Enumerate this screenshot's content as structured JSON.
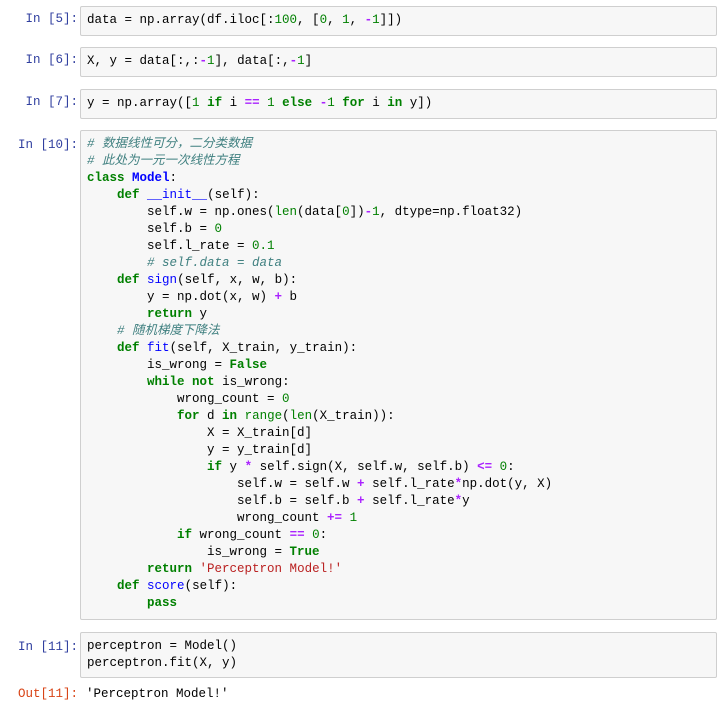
{
  "cells": [
    {
      "prompt": "In  [5]:",
      "lines": [
        "data = np.array(df.iloc[:100, [0, 1, -1]])"
      ]
    },
    {
      "prompt": "In  [6]:",
      "lines": [
        "X, y = data[:,:-1], data[:,-1]"
      ]
    },
    {
      "prompt": "In  [7]:",
      "lines": [
        "y = np.array([1 if i == 1 else -1 for i in y])"
      ]
    },
    {
      "prompt": "In  [10]:",
      "lines": [
        "# 数据线性可分，二分类数据",
        "# 此处为一元一次线性方程",
        "class Model:",
        "    def __init__(self):",
        "        self.w = np.ones(len(data[0])-1, dtype=np.float32)",
        "        self.b = 0",
        "        self.l_rate = 0.1",
        "        # self.data = data",
        "    def sign(self, x, w, b):",
        "        y = np.dot(x, w) + b",
        "        return y",
        "    # 随机梯度下降法",
        "    def fit(self, X_train, y_train):",
        "        is_wrong = False",
        "        while not is_wrong:",
        "            wrong_count = 0",
        "            for d in range(len(X_train)):",
        "                X = X_train[d]",
        "                y = y_train[d]",
        "                if y * self.sign(X, self.w, self.b) <= 0:",
        "                    self.w = self.w + self.l_rate*np.dot(y, X)",
        "                    self.b = self.b + self.l_rate*y",
        "                    wrong_count += 1",
        "            if wrong_count == 0:",
        "                is_wrong = True",
        "        return 'Perceptron Model!'",
        "    def score(self):",
        "        pass"
      ]
    },
    {
      "prompt": "In  [11]:",
      "lines": [
        "perceptron = Model()",
        "perceptron.fit(X, y)"
      ]
    }
  ],
  "output": {
    "prompt": "Out[11]:",
    "text": "'Perceptron Model!'"
  }
}
